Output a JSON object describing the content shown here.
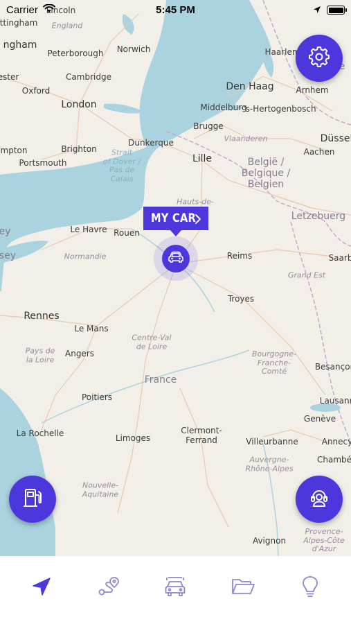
{
  "status_bar": {
    "carrier": "Carrier",
    "time": "5:45 PM"
  },
  "map": {
    "labels": [
      {
        "text": "Lincoln",
        "cls": "city"
      },
      {
        "text": "ttingham",
        "cls": "city"
      },
      {
        "text": "England",
        "cls": "region"
      },
      {
        "text": "ngham",
        "cls": "city big"
      },
      {
        "text": "Peterborough",
        "cls": "city"
      },
      {
        "text": "Norwich",
        "cls": "city"
      },
      {
        "text": "ester",
        "cls": "city"
      },
      {
        "text": "Cambridge",
        "cls": "city"
      },
      {
        "text": "Oxford",
        "cls": "city"
      },
      {
        "text": "London",
        "cls": "city big"
      },
      {
        "text": "mpton",
        "cls": "city"
      },
      {
        "text": "Brighton",
        "cls": "city"
      },
      {
        "text": "Portsmouth",
        "cls": "city"
      },
      {
        "text": "Strait\nof Dover /\nPas de\nCalais",
        "cls": "sea ml"
      },
      {
        "text": "Haarlem",
        "cls": "city"
      },
      {
        "text": "Nede",
        "cls": "country"
      },
      {
        "text": "Den Haag",
        "cls": "city big"
      },
      {
        "text": "Arnhem",
        "cls": "city"
      },
      {
        "text": "Middelburg",
        "cls": "city"
      },
      {
        "text": "'s-Hertogenbosch",
        "cls": "city"
      },
      {
        "text": "Brugge",
        "cls": "city"
      },
      {
        "text": "Vlaanderen",
        "cls": "region"
      },
      {
        "text": "Dunkerque",
        "cls": "city"
      },
      {
        "text": "Aachen",
        "cls": "city"
      },
      {
        "text": "Düssel",
        "cls": "city big"
      },
      {
        "text": "Lille",
        "cls": "city big"
      },
      {
        "text": "België /\nBelgique /\nBelgien",
        "cls": "country ml"
      },
      {
        "text": "Hauts-de-\nFrance",
        "cls": "region ml"
      },
      {
        "text": "Letzebuerg",
        "cls": "country"
      },
      {
        "text": "ey",
        "cls": "country"
      },
      {
        "text": "Le Havre",
        "cls": "city"
      },
      {
        "text": "Rouen",
        "cls": "city"
      },
      {
        "text": "sey",
        "cls": "country"
      },
      {
        "text": "Normandie",
        "cls": "region"
      },
      {
        "text": "Reims",
        "cls": "city"
      },
      {
        "text": "Saarb",
        "cls": "city"
      },
      {
        "text": "Grand Est",
        "cls": "region"
      },
      {
        "text": "Troyes",
        "cls": "city"
      },
      {
        "text": "Rennes",
        "cls": "city big"
      },
      {
        "text": "Le Mans",
        "cls": "city"
      },
      {
        "text": "Centre-Val\nde Loire",
        "cls": "region ml"
      },
      {
        "text": "Pays de\nla Loire",
        "cls": "region ml"
      },
      {
        "text": "Angers",
        "cls": "city"
      },
      {
        "text": "Bourgogne-\nFranche-\nComté",
        "cls": "region ml"
      },
      {
        "text": "Besançon",
        "cls": "city"
      },
      {
        "text": "France",
        "cls": "country"
      },
      {
        "text": "Poitiers",
        "cls": "city"
      },
      {
        "text": "Lausann",
        "cls": "city"
      },
      {
        "text": "Genève",
        "cls": "city"
      },
      {
        "text": "La Rochelle",
        "cls": "city"
      },
      {
        "text": "Limoges",
        "cls": "city"
      },
      {
        "text": "Clermont-\nFerrand",
        "cls": "city ml"
      },
      {
        "text": "Villeurbanne",
        "cls": "city"
      },
      {
        "text": "Annecy",
        "cls": "city"
      },
      {
        "text": "Chambé",
        "cls": "city"
      },
      {
        "text": "Auvergne-\nRhône-Alpes",
        "cls": "region ml"
      },
      {
        "text": "Nouvelle-\nAquitaine",
        "cls": "region ml"
      },
      {
        "text": "Avignon",
        "cls": "city"
      },
      {
        "text": "Provence-\nAlpes-Côte\nd'Azur",
        "cls": "region ml"
      }
    ]
  },
  "car_callout": {
    "label": "MY CAR"
  },
  "colors": {
    "accent": "#4b37dc",
    "tab_inactive": "#8e85d6",
    "water": "#aad3df",
    "land": "#f2efe9"
  },
  "buttons": {
    "settings": {
      "icon": "gear-icon"
    },
    "fuel": {
      "icon": "fuel-pump-icon"
    },
    "assist": {
      "icon": "headset-icon"
    }
  },
  "tabs": [
    {
      "icon": "navigation-arrow-icon",
      "active": true
    },
    {
      "icon": "route-icon",
      "active": false
    },
    {
      "icon": "car-icon",
      "active": false
    },
    {
      "icon": "folder-icon",
      "active": false
    },
    {
      "icon": "lightbulb-icon",
      "active": false
    }
  ]
}
